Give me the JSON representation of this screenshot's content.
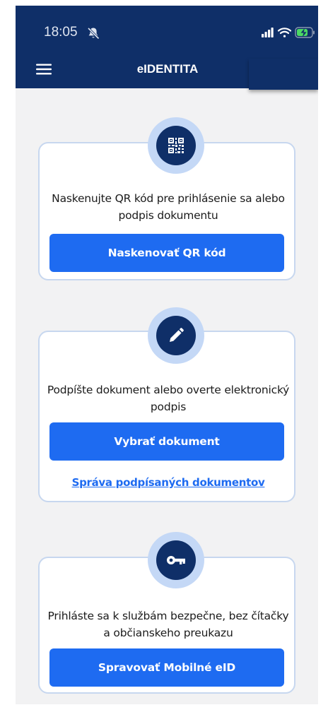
{
  "status_bar": {
    "time": "18:05",
    "icons": [
      "bell-slash-icon",
      "signal-icon",
      "wifi-icon",
      "battery-charging-icon"
    ]
  },
  "header": {
    "title": "eIDENTITA",
    "menu_icon": "hamburger-menu-icon",
    "background": "#0f2f68"
  },
  "cards": [
    {
      "icon": "qr-code-icon",
      "description": "Naskenujte QR kód pre prihlásenie sa alebo podpis dokumentu",
      "button_label": "Naskenovať QR kód"
    },
    {
      "icon": "pencil-icon",
      "description": "Podpíšte dokument alebo overte elektronický podpis",
      "button_label": "Vybrať dokument",
      "link_label": "Správa podpísaných dokumentov"
    },
    {
      "icon": "key-icon",
      "description": "Prihláste sa k službám bezpečne, bez čítačky a občianskeho preukazu",
      "button_label": "Spravovať Mobilné eID"
    }
  ],
  "colors": {
    "primary_button": "#1e6bf1",
    "link": "#1e6bf1",
    "card_border": "#c7d7ef",
    "icon_ring": "#c4d8f6",
    "background": "#f2f2f3"
  }
}
